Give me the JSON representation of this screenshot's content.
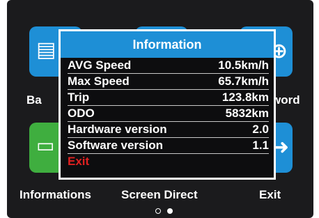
{
  "tiles": [
    {
      "label": "Ba",
      "color": "#1e8fd6"
    },
    {
      "label": "word",
      "color": "#1e8fd6"
    },
    {
      "label": "Informations",
      "color": "#3fae3f"
    },
    {
      "label": "Screen Direct",
      "color": "#1e8fd6"
    },
    {
      "label": "Exit",
      "color": "#1e8fd6"
    }
  ],
  "pager": {
    "pages": 2,
    "active": 2
  },
  "dialog": {
    "title": "Information",
    "rows": [
      {
        "label": "AVG Speed",
        "value": "10.5km/h"
      },
      {
        "label": "Max Speed",
        "value": "65.7km/h"
      },
      {
        "label": "Trip",
        "value": "123.8km"
      },
      {
        "label": "ODO",
        "value": "5832km"
      },
      {
        "label": "Hardware version",
        "value": "2.0"
      },
      {
        "label": "Software version",
        "value": "1.1"
      }
    ],
    "exit_label": "Exit"
  },
  "colors": {
    "accent": "#1e8fd6",
    "green": "#3fae3f",
    "exit": "#e02020",
    "background": "#1b1b1d"
  }
}
